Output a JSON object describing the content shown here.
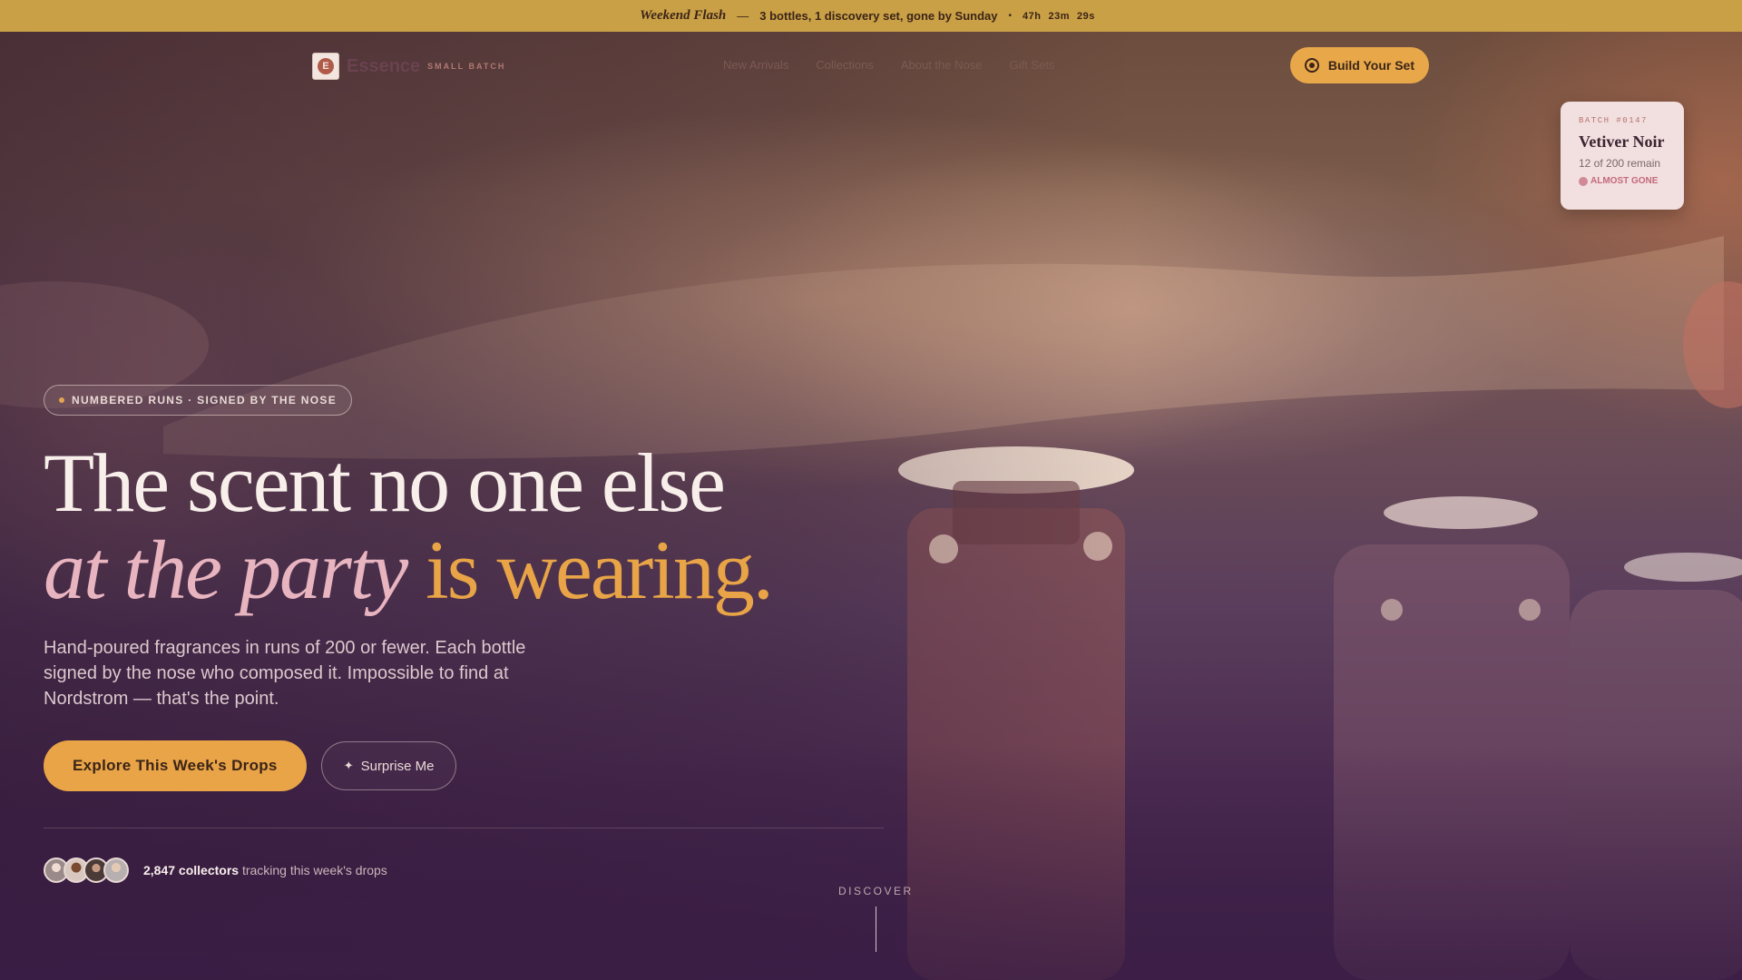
{
  "announcement": {
    "flash_label": "Weekend Flash",
    "separator": "—",
    "message": "3 bottles, 1 discovery set, gone by Sunday",
    "bullet": "•",
    "timer": {
      "hours": "47h",
      "minutes": "23m",
      "seconds": "29s"
    }
  },
  "nav": {
    "logo_glyph": "E",
    "brand": "Essence",
    "tagline": "SMALL BATCH",
    "links": [
      "New Arrivals",
      "Collections",
      "About the Nose",
      "Gift Sets"
    ],
    "cta": "Build Your Set"
  },
  "batch_card": {
    "label": "BATCH #0147",
    "title": "Vetiver Noir",
    "remaining": "12 of 200 remain",
    "status": "ALMOST GONE"
  },
  "hero": {
    "eyebrow": "NUMBERED RUNS · SIGNED BY THE NOSE",
    "headline_line1": "The scent no one else",
    "headline_italic": "at the party",
    "headline_gold": " is wearing.",
    "subcopy": "Hand-poured fragrances in runs of 200 or fewer. Each bottle signed by the nose who composed it. Impossible to find at Nordstrom — that's the point.",
    "primary_cta": "Explore This Week's Drops",
    "secondary_cta": "Surprise Me",
    "secondary_icon": "✦",
    "collectors_count": "2,847 collectors",
    "collectors_text": " tracking this week's drops"
  },
  "discover": "DISCOVER",
  "colors": {
    "accent_gold": "#e8a446",
    "accent_pink": "#e7b4bf",
    "announcement_bg": "#c9a046",
    "card_bg": "#f2dfe0"
  }
}
